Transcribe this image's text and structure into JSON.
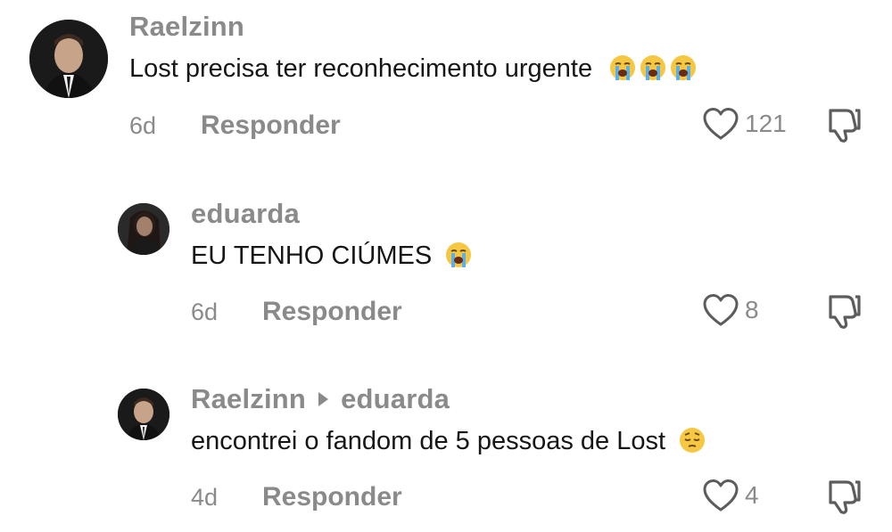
{
  "comments": [
    {
      "username": "Raelzinn",
      "text": "Lost precisa ter reconhecimento urgente",
      "emojis": [
        "loudly-crying-face",
        "loudly-crying-face",
        "loudly-crying-face"
      ],
      "time": "6d",
      "reply_label": "Responder",
      "likes": "121"
    },
    {
      "username": "eduarda",
      "text": "EU TENHO CIÚMES",
      "emojis": [
        "loudly-crying-face"
      ],
      "time": "6d",
      "reply_label": "Responder",
      "likes": "8"
    },
    {
      "username": "Raelzinn",
      "reply_to": "eduarda",
      "text": "encontrei o fandom de 5 pessoas de Lost",
      "emojis": [
        "pensive-face"
      ],
      "time": "4d",
      "reply_label": "Responder",
      "likes": "4"
    }
  ],
  "colors": {
    "username": "#8a8a8a",
    "text": "#161616",
    "meta": "#8a8a8a",
    "icon": "#5c5c5c"
  }
}
